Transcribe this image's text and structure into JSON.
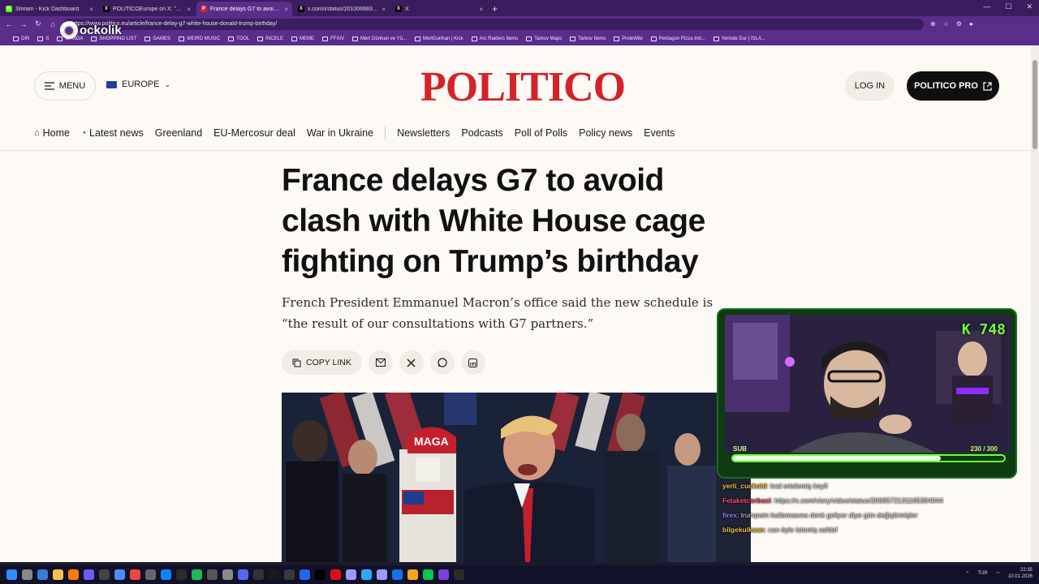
{
  "browser": {
    "tabs": [
      {
        "label": "Stream - Kick Dashboard",
        "color": "#53fc18",
        "glyph": "K",
        "active": false
      },
      {
        "label": "POLITICOEurope on X: \"🚨 BREAKING",
        "color": "#000000",
        "glyph": "X",
        "active": false
      },
      {
        "label": "France delays G7 to avoid clash wi",
        "color": "#d2232a",
        "glyph": "P",
        "active": true
      },
      {
        "label": "x.com/i/status/20100668389320",
        "color": "#000000",
        "glyph": "X",
        "active": false
      },
      {
        "label": "X",
        "color": "#000000",
        "glyph": "X",
        "active": false
      }
    ],
    "url": "https://www.politico.eu/article/france-delay-g7-white-house-donald-trump-birthday/",
    "bookmarks": [
      "DIR",
      "S",
      "MANGA",
      "SHOPPING LIST",
      "GAMES",
      "WEIRD MUSIC",
      "TOOL",
      "İNCELE",
      "MEME",
      "FFXIV",
      "Mert Günhan ve Yü...",
      "MertGunhan | Kick",
      "Arc Raiders Items",
      "Tarkov Maps",
      "Tarkov Items",
      "ProleWiki",
      "Pentagon Pizza Ind...",
      "Yerinde Dur | İSLA..."
    ],
    "overlay_logo": "ockolik"
  },
  "site": {
    "menu_label": "MENU",
    "region_label": "EUROPE",
    "brand": "POLITICO",
    "login_label": "LOG IN",
    "pro_label": "POLITICO PRO",
    "nav": [
      "Home",
      "Latest news",
      "Greenland",
      "EU-Mercosur deal",
      "War in Ukraine",
      "Newsletters",
      "Podcasts",
      "Poll of Polls",
      "Policy news",
      "Events"
    ]
  },
  "article": {
    "headline": "France delays G7 to avoid clash with White House cage fighting on Trump’s birthday",
    "dek": "French President Emmanuel Macron’s office said the new schedule is “the result of our consultations with G7 partners.”",
    "copy_link_label": "COPY LINK",
    "share_icons": [
      "mail-icon",
      "x-icon",
      "whatsapp-icon",
      "linkedin-icon"
    ]
  },
  "stream": {
    "counter": "K 748",
    "sub_label": "SUB",
    "sub_count": "230 / 300",
    "sub_progress": 0.767,
    "chat": [
      {
        "user": "yerli_cuckold",
        "color": "#f0c23a",
        "text": ": kral ertelemiş keyfi"
      },
      {
        "user": "Felaketcorbaci",
        "color": "#ff4a6b",
        "text": ": https://x.com/viory/video/status/2008572131165394044"
      },
      {
        "user": "firex",
        "color": "#9f7bff",
        "text": ": trumpwin kutlamasına denk geliyor diye gün değiştirmişler"
      },
      {
        "user": "bilgekulkaan",
        "color": "#f0c23a",
        "text": ": can öyle istemiş asfdsf"
      }
    ]
  },
  "taskbar": {
    "lang": "TUR",
    "time": "22:35",
    "date": "10.01.2026"
  }
}
